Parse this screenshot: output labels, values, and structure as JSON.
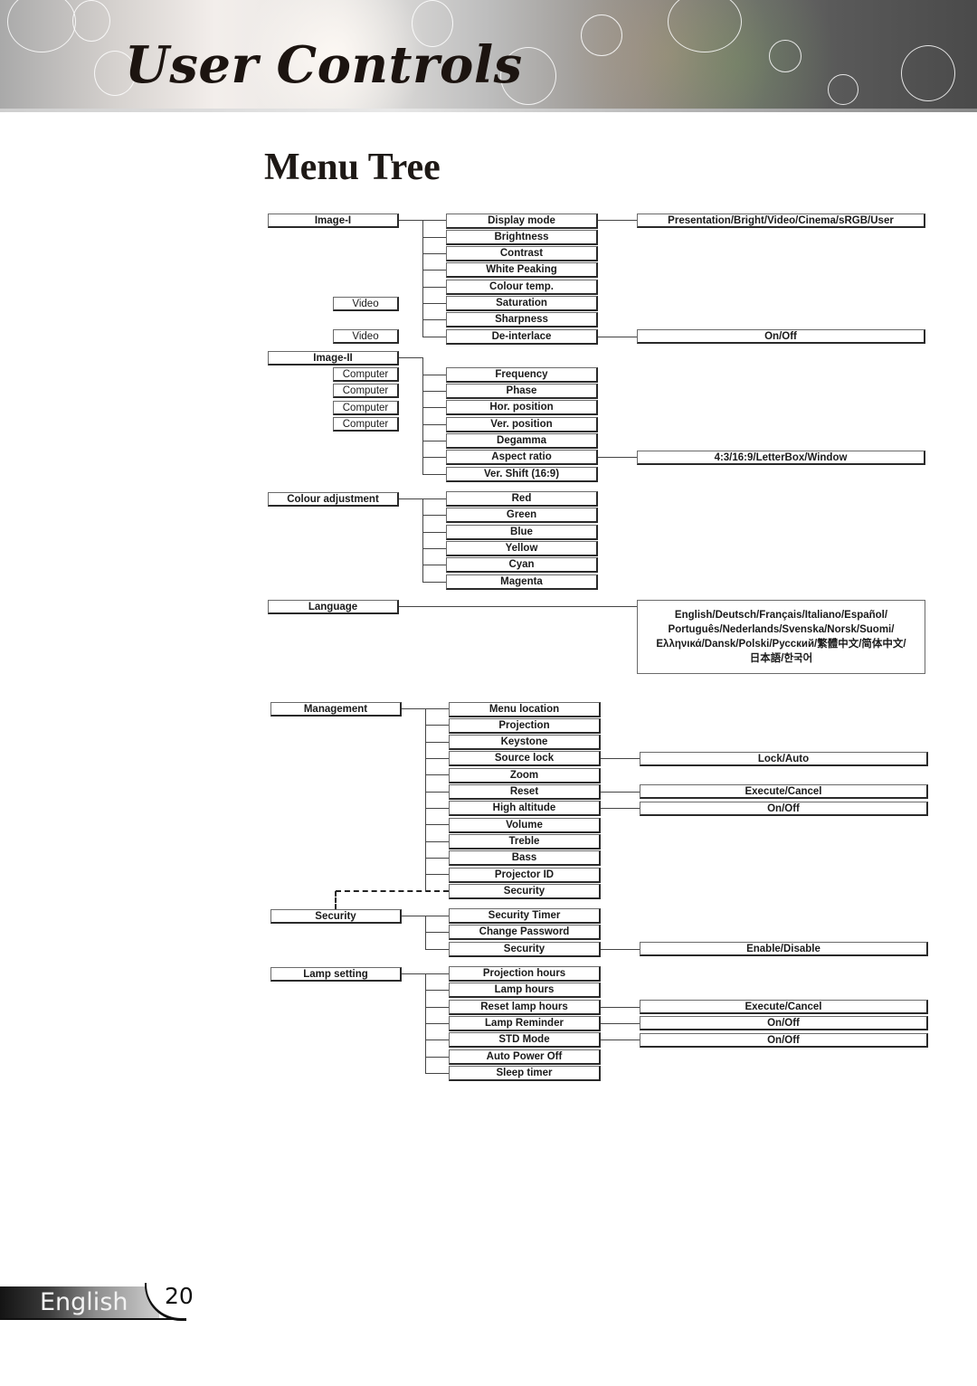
{
  "header": {
    "section_title": "User Controls"
  },
  "page": {
    "title": "Menu Tree",
    "language": "English",
    "page_number": "20"
  },
  "menu_tree": {
    "image1": {
      "label": "Image-I",
      "items": [
        "Display mode",
        "Brightness",
        "Contrast",
        "White Peaking",
        "Colour temp.",
        "Saturation",
        "Sharpness",
        "De-interlace"
      ],
      "source_tags": {
        "saturation": "Video",
        "deinterlace": "Video"
      },
      "options": {
        "display_mode": "Presentation/Bright/Video/Cinema/sRGB/User",
        "deinterlace": "On/Off"
      }
    },
    "image2": {
      "label": "Image-II",
      "items": [
        "Frequency",
        "Phase",
        "Hor. position",
        "Ver. position",
        "Degamma",
        "Aspect ratio",
        "Ver. Shift (16:9)"
      ],
      "source_tags": [
        "Computer",
        "Computer",
        "Computer",
        "Computer"
      ],
      "options": {
        "aspect_ratio": "4:3/16:9/LetterBox/Window"
      }
    },
    "colour": {
      "label": "Colour adjustment",
      "items": [
        "Red",
        "Green",
        "Blue",
        "Yellow",
        "Cyan",
        "Magenta"
      ]
    },
    "language": {
      "label": "Language",
      "options_lines": [
        "English/Deutsch/Français/Italiano/Español/",
        "Português/Nederlands/Svenska/Norsk/Suomi/",
        "Ελληνικά/Dansk/Polski/Русский/繁體中文/简体中文/",
        "日本語/한국어"
      ]
    },
    "management": {
      "label": "Management",
      "items": [
        "Menu location",
        "Projection",
        "Keystone",
        "Source lock",
        "Zoom",
        "Reset",
        "High altitude",
        "Volume",
        "Treble",
        "Bass",
        "Projector ID",
        "Security"
      ],
      "options": {
        "source_lock": "Lock/Auto",
        "reset": "Execute/Cancel",
        "high_altitude": "On/Off"
      }
    },
    "security": {
      "label": "Security",
      "items": [
        "Security Timer",
        "Change Password",
        "Security"
      ],
      "options": {
        "security": "Enable/Disable"
      }
    },
    "lamp": {
      "label": "Lamp setting",
      "items": [
        "Projection hours",
        "Lamp hours",
        "Reset lamp hours",
        "Lamp Reminder",
        "STD Mode",
        "Auto Power Off",
        "Sleep timer"
      ],
      "options": {
        "reset_lamp_hours": "Execute/Cancel",
        "lamp_reminder": "On/Off",
        "std_mode": "On/Off"
      }
    }
  }
}
